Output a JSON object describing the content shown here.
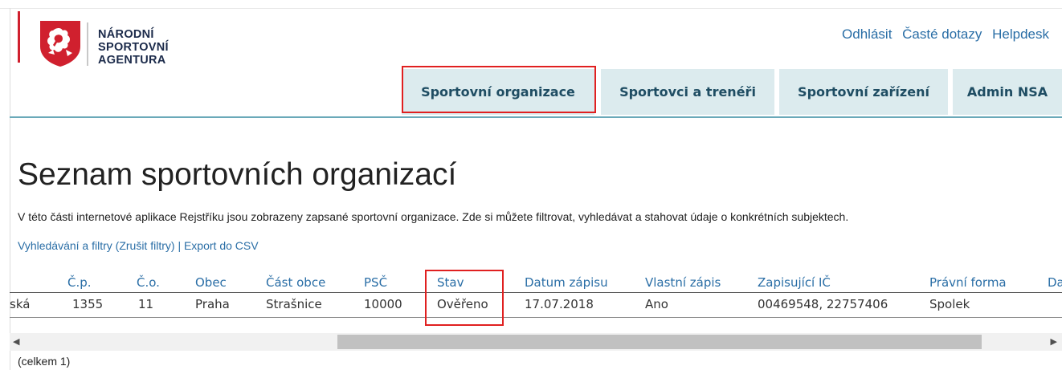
{
  "brand": {
    "line1": "NÁRODNÍ",
    "line2": "SPORTOVNÍ",
    "line3": "AGENTURA",
    "emblem_icon": "czech-lion-emblem-icon",
    "accent_color": "#d0202e"
  },
  "header_links": [
    "Odhlásit",
    "Časté dotazy",
    "Helpdesk"
  ],
  "nav": {
    "tabs": [
      "Sportovní organizace",
      "Sportovci a trenéři",
      "Sportovní zařízení",
      "Admin NSA"
    ],
    "active_tab": "Sportovní organizace",
    "tab_color": "#dcebee"
  },
  "page": {
    "title": "Seznam sportovních organizací",
    "description": "V této části internetové aplikace Rejstříku jsou zobrazeny zapsané sportovní organizace. Zde si můžete filtrovat, vyhledávat a stahovat údaje o konkrétních subjektech.",
    "links": {
      "search": "Vyhledávání a filtry",
      "reset": "(Zrušit filtry)",
      "separator": "|",
      "export": "Export do CSV"
    },
    "total": "(celkem 1)"
  },
  "table": {
    "columns": [
      "Č.p.",
      "Č.o.",
      "Obec",
      "Část obce",
      "PSČ",
      "Stav",
      "Datum zápisu",
      "Vlastní zápis",
      "Zapisující IČ",
      "Právní forma",
      "Da"
    ],
    "rows": [
      {
        "cells": [
          "ská",
          "1355",
          "11",
          "Praha",
          "Strašnice",
          "10000",
          "Ověřeno",
          "17.07.2018",
          "Ano",
          "00469548, 22757406",
          "Spolek"
        ]
      }
    ]
  },
  "scrollbar": {
    "left_arrow_icon": "triangle-left-icon",
    "right_arrow_icon": "triangle-right-icon"
  }
}
